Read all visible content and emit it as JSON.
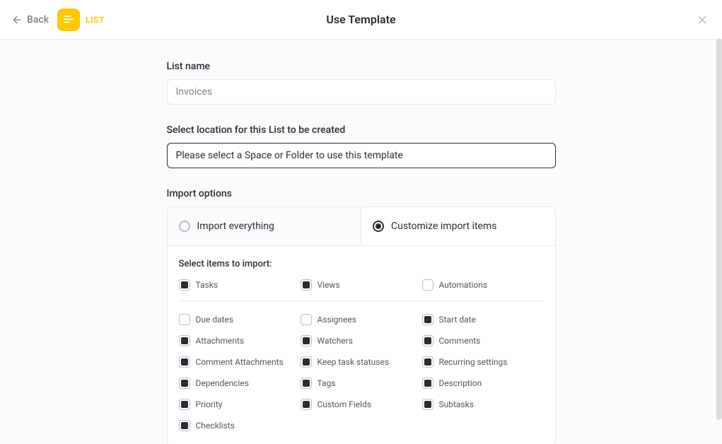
{
  "header": {
    "back_label": "Back",
    "type_label": "LIST",
    "page_title": "Use Template"
  },
  "list_name": {
    "label": "List name",
    "placeholder": "Invoices",
    "value": ""
  },
  "location": {
    "label": "Select location for this List to be created",
    "placeholder": "Please select a Space or Folder to use this template"
  },
  "import": {
    "label": "Import options",
    "option_all": "Import everything",
    "option_custom": "Customize import items",
    "panel_label": "Select items to import:",
    "top_items": [
      {
        "label": "Tasks",
        "checked": true
      },
      {
        "label": "Views",
        "checked": true
      },
      {
        "label": "Automations",
        "checked": false
      }
    ],
    "items": [
      {
        "label": "Due dates",
        "checked": false
      },
      {
        "label": "Assignees",
        "checked": false
      },
      {
        "label": "Start date",
        "checked": true
      },
      {
        "label": "Attachments",
        "checked": true
      },
      {
        "label": "Watchers",
        "checked": true
      },
      {
        "label": "Comments",
        "checked": true
      },
      {
        "label": "Comment Attachments",
        "checked": true
      },
      {
        "label": "Keep task statuses",
        "checked": true
      },
      {
        "label": "Recurring settings",
        "checked": true
      },
      {
        "label": "Dependencies",
        "checked": true
      },
      {
        "label": "Tags",
        "checked": true
      },
      {
        "label": "Description",
        "checked": true
      },
      {
        "label": "Priority",
        "checked": true
      },
      {
        "label": "Custom Fields",
        "checked": true
      },
      {
        "label": "Subtasks",
        "checked": true
      },
      {
        "label": "Checklists",
        "checked": true
      }
    ]
  }
}
